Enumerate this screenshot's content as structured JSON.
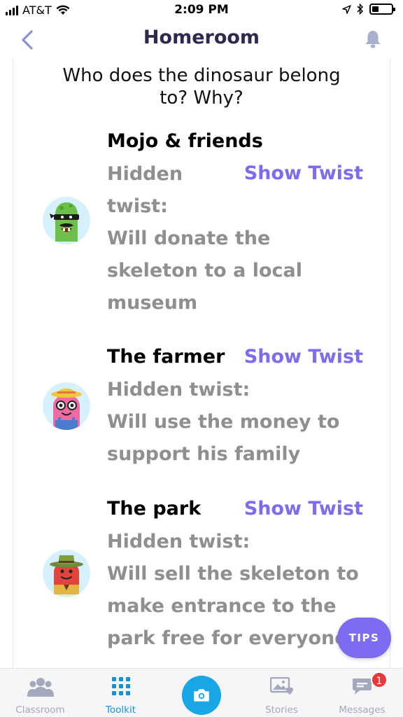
{
  "status_bar": {
    "carrier": "AT&T",
    "time": "2:09 PM"
  },
  "header": {
    "title": "Homeroom",
    "back_icon": "chevron-left-icon",
    "bell_icon": "bell-icon"
  },
  "question": {
    "line1": "Who does the dinosaur belong",
    "line2": "to? Why?"
  },
  "options": [
    {
      "title": "Mojo & friends",
      "show_twist": "Show Twist",
      "twist_lines": [
        "Hidden",
        "twist:",
        "Will donate the",
        "skeleton to a local",
        "museum"
      ],
      "avatar": "green-monster-ninja-avatar"
    },
    {
      "title": "The farmer",
      "show_twist": "Show Twist",
      "twist_lines": [
        "Hidden twist:",
        "Will use the money to",
        "support his family"
      ],
      "avatar": "pink-monster-farmer-avatar"
    },
    {
      "title": "The park",
      "show_twist": "Show Twist",
      "twist_lines": [
        "Hidden twist:",
        "Will sell the skeleton to",
        "make entrance to the",
        "park free for everyone"
      ],
      "avatar": "red-monster-ranger-avatar"
    }
  ],
  "tips_button": "TIPS",
  "tab_bar": {
    "tabs": [
      {
        "label": "Classroom",
        "icon": "people-icon"
      },
      {
        "label": "Toolkit",
        "icon": "grid-icon"
      },
      {
        "label": "",
        "icon": "camera-icon"
      },
      {
        "label": "Stories",
        "icon": "photo-heart-icon"
      },
      {
        "label": "Messages",
        "icon": "chat-bubble-icon",
        "badge": "1"
      }
    ],
    "active": "Toolkit"
  },
  "colors": {
    "accent": "#7d6cf0",
    "title": "#2d2a4d",
    "twist_text": "#8f8f8f",
    "tab_active": "#1591d6",
    "camera": "#19a6e6",
    "badge": "#e8393a"
  }
}
